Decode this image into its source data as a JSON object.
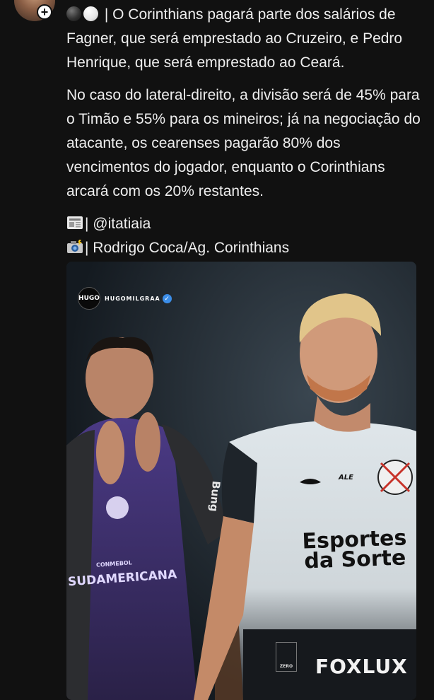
{
  "post": {
    "paragraph1": "| O Corinthians pagará parte dos salários de Fagner, que será emprestado ao Cruzeiro, e Pedro Henrique, que será emprestado ao Ceará.",
    "paragraph2": "No caso do lateral-direito, a divisão será de 45% para o Timão e 55% para os mineiros; já na negociação do atacante, os cearenses pagarão 80% dos vencimentos do jogador, enquanto o Corinthians arcará com os 20% restantes.",
    "source_line": "| @itatiaia",
    "photo_credit_line": "| Rodrigo Coca/Ag. Corinthians",
    "icons": {
      "emoji1": "black-circle-icon",
      "emoji2": "white-circle-icon",
      "source": "newspaper-icon",
      "photo": "camera-flash-icon"
    }
  },
  "photo": {
    "watermark_logo": "HUGO",
    "watermark_handle": "HUGOMILGRAA",
    "jersey_sponsor_line1": "Esportes",
    "jersey_sponsor_line2": "da Sorte",
    "jersey_chest_logo": "ALE",
    "sleeve_brand": "Bung",
    "vest_sub": "CONMEBOL",
    "vest_text": "SUDAMERICANA",
    "shorts_brand": "FOXLUX",
    "shorts_patch": "ZERO"
  },
  "colors": {
    "background": "#111111",
    "text": "#eeeeee",
    "verified": "#3b8de8"
  }
}
